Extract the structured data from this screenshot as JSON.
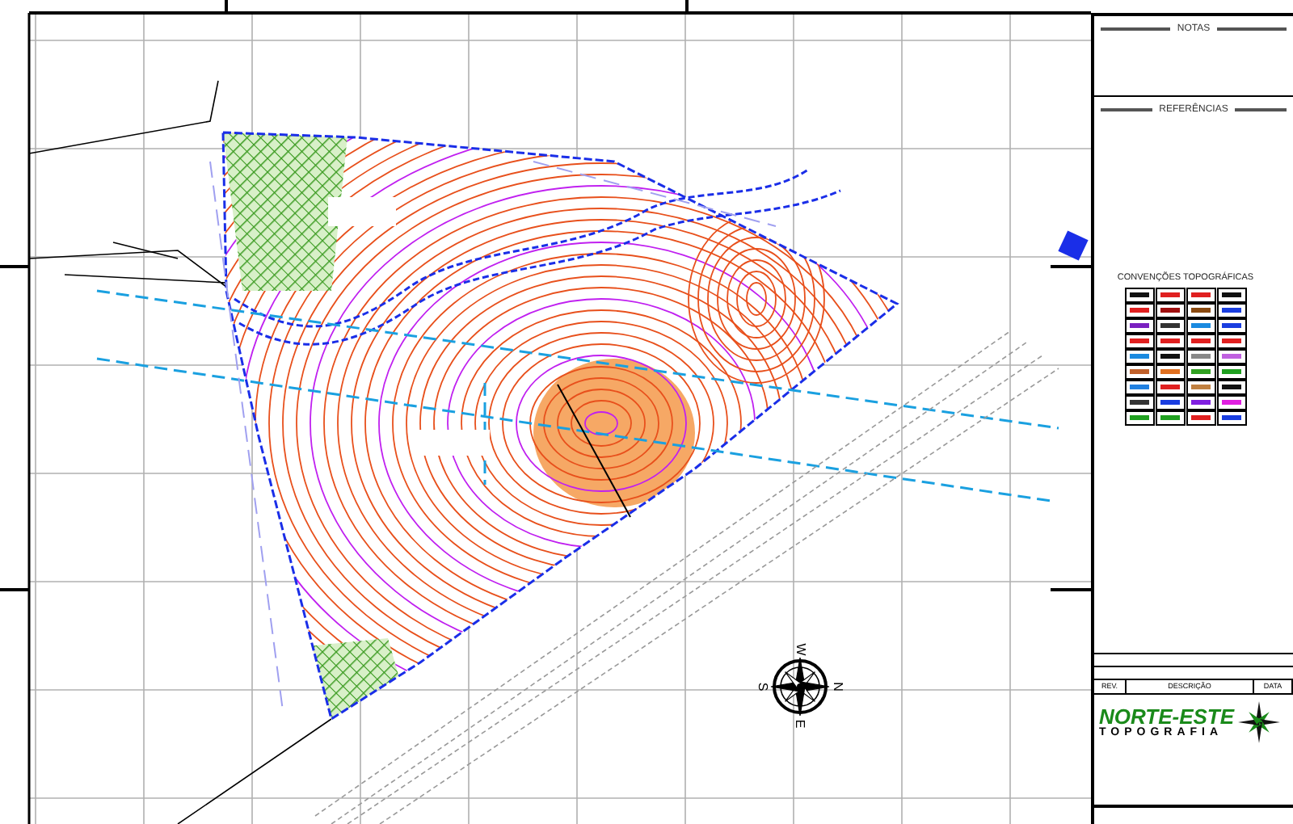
{
  "notes": {
    "title": "NOTAS"
  },
  "references": {
    "title": "REFERÊNCIAS"
  },
  "legend": {
    "title": "CONVENÇÕES TOPOGRÁFICAS"
  },
  "revision_table": {
    "columns": [
      "REV.",
      "DESCRIÇÃO",
      "DATA"
    ]
  },
  "logo": {
    "name": "NORTE-ESTE",
    "tagline": "TOPOGRAFIA"
  },
  "compass": {
    "top": "W",
    "right": "N",
    "bottom": "E",
    "left": "S"
  }
}
